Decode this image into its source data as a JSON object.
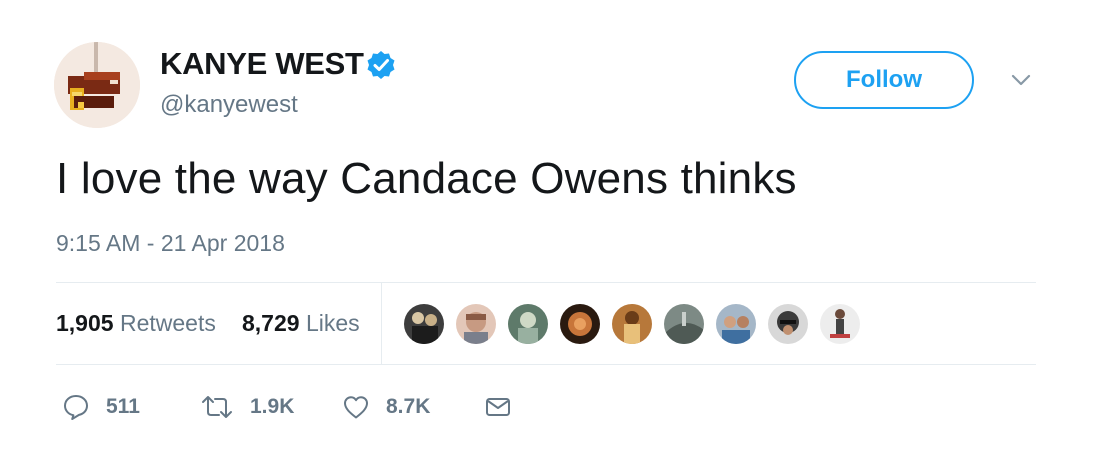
{
  "author": {
    "display_name": "KANYE WEST",
    "handle": "@kanyewest",
    "verified": true
  },
  "follow_label": "Follow",
  "tweet": {
    "text": "I love the way Candace Owens thinks",
    "timestamp": "9:15 AM - 21 Apr 2018"
  },
  "stats": {
    "retweets_count": "1,905",
    "retweets_label": "Retweets",
    "likes_count": "8,729",
    "likes_label": "Likes"
  },
  "actions": {
    "reply_count": "511",
    "retweet_count": "1.9K",
    "like_count": "8.7K"
  },
  "colors": {
    "accent": "#1da1f2",
    "text": "#14171a",
    "secondary": "#657786",
    "divider": "#e6ecf0"
  },
  "icons": {
    "verified": "verified-badge-icon",
    "caret": "chevron-down-icon",
    "reply": "reply-icon",
    "retweet": "retweet-icon",
    "like": "heart-icon",
    "dm": "envelope-icon"
  }
}
